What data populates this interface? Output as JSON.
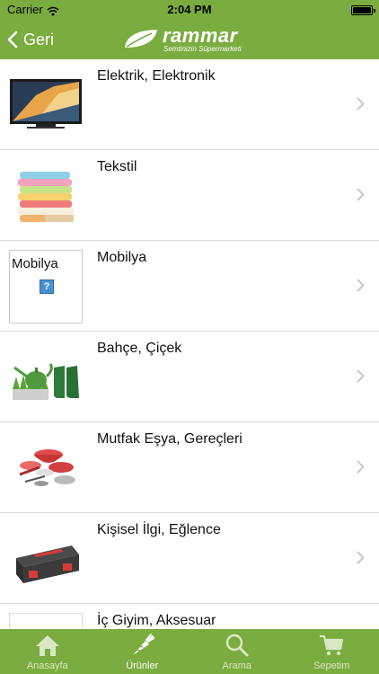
{
  "status_bar": {
    "carrier": "Carrier",
    "time": "2:04 PM"
  },
  "nav": {
    "back_label": "Geri",
    "logo_name": "rammar",
    "logo_tagline": "Semtinizin Süpermarketi"
  },
  "categories": [
    {
      "label": "Elektrik, Elektronik",
      "image": "tv-image"
    },
    {
      "label": "Tekstil",
      "image": "towels-image"
    },
    {
      "label": "Mobilya",
      "image": "broken-image",
      "placeholder_text": "Mobilya"
    },
    {
      "label": "Bahçe, Çiçek",
      "image": "garden-image"
    },
    {
      "label": "Mutfak Eşya, Gereçleri",
      "image": "kitchenware-image"
    },
    {
      "label": "Kişisel İlgi, Eğlence",
      "image": "toolbox-image"
    },
    {
      "label": "İç Giyim, Aksesuar",
      "image": "underwear-image"
    }
  ],
  "tabbar": {
    "items": [
      {
        "label": "Anasayfa",
        "icon": "home-icon",
        "active": false
      },
      {
        "label": "Ürünler",
        "icon": "carrot-icon",
        "active": true
      },
      {
        "label": "Arama",
        "icon": "search-icon",
        "active": false
      },
      {
        "label": "Sepetim",
        "icon": "cart-icon",
        "active": false
      }
    ]
  },
  "colors": {
    "brand_green": "#7bac3f",
    "tab_inactive": "#d9e7c5",
    "separator": "#d9d9d9"
  }
}
